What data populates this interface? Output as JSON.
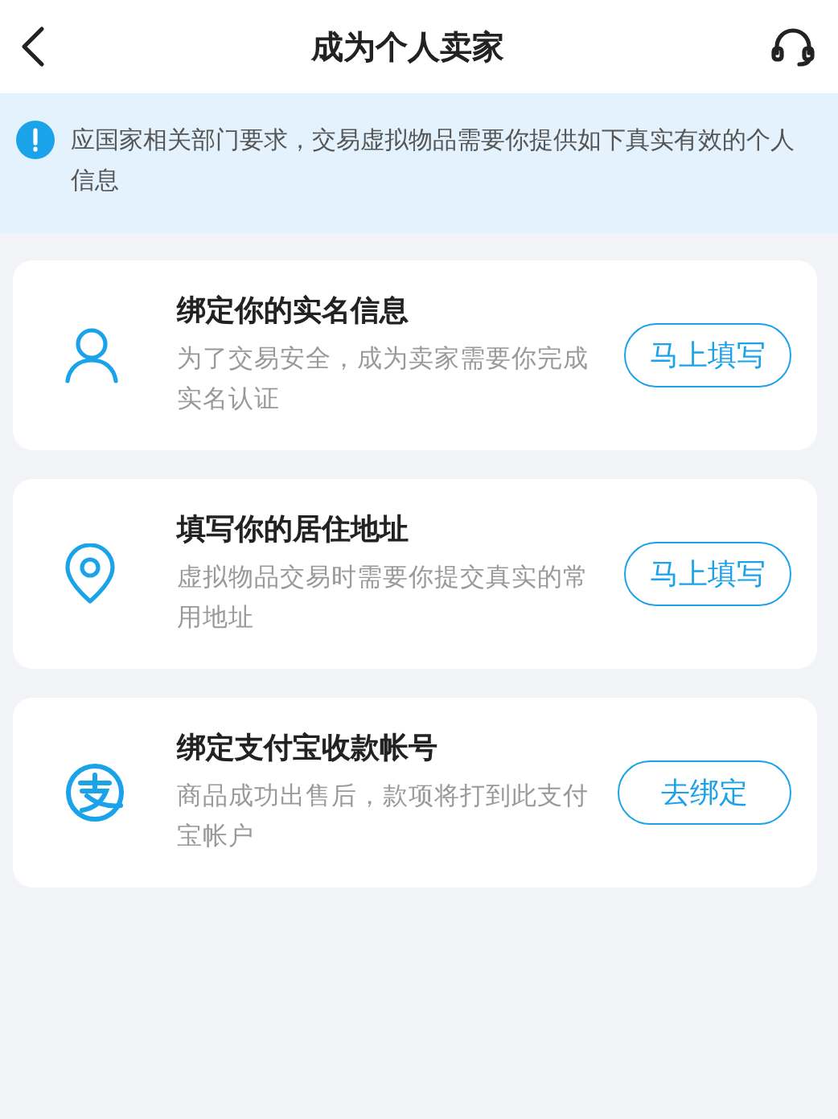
{
  "header": {
    "title": "成为个人卖家"
  },
  "notice": {
    "text": "应国家相关部门要求，交易虚拟物品需要你提供如下真实有效的个人信息"
  },
  "steps": [
    {
      "kind": "person",
      "title": "绑定你的实名信息",
      "description": "为了交易安全，成为卖家需要你完成实名认证",
      "button": "马上填写"
    },
    {
      "kind": "location",
      "title": "填写你的居住地址",
      "description": "虚拟物品交易时需要你提交真实的常用地址",
      "button": "马上填写"
    },
    {
      "kind": "pay",
      "title": "绑定支付宝收款帐号",
      "description": "商品成功出售后，款项将打到此支付宝帐户",
      "button": "去绑定"
    }
  ]
}
